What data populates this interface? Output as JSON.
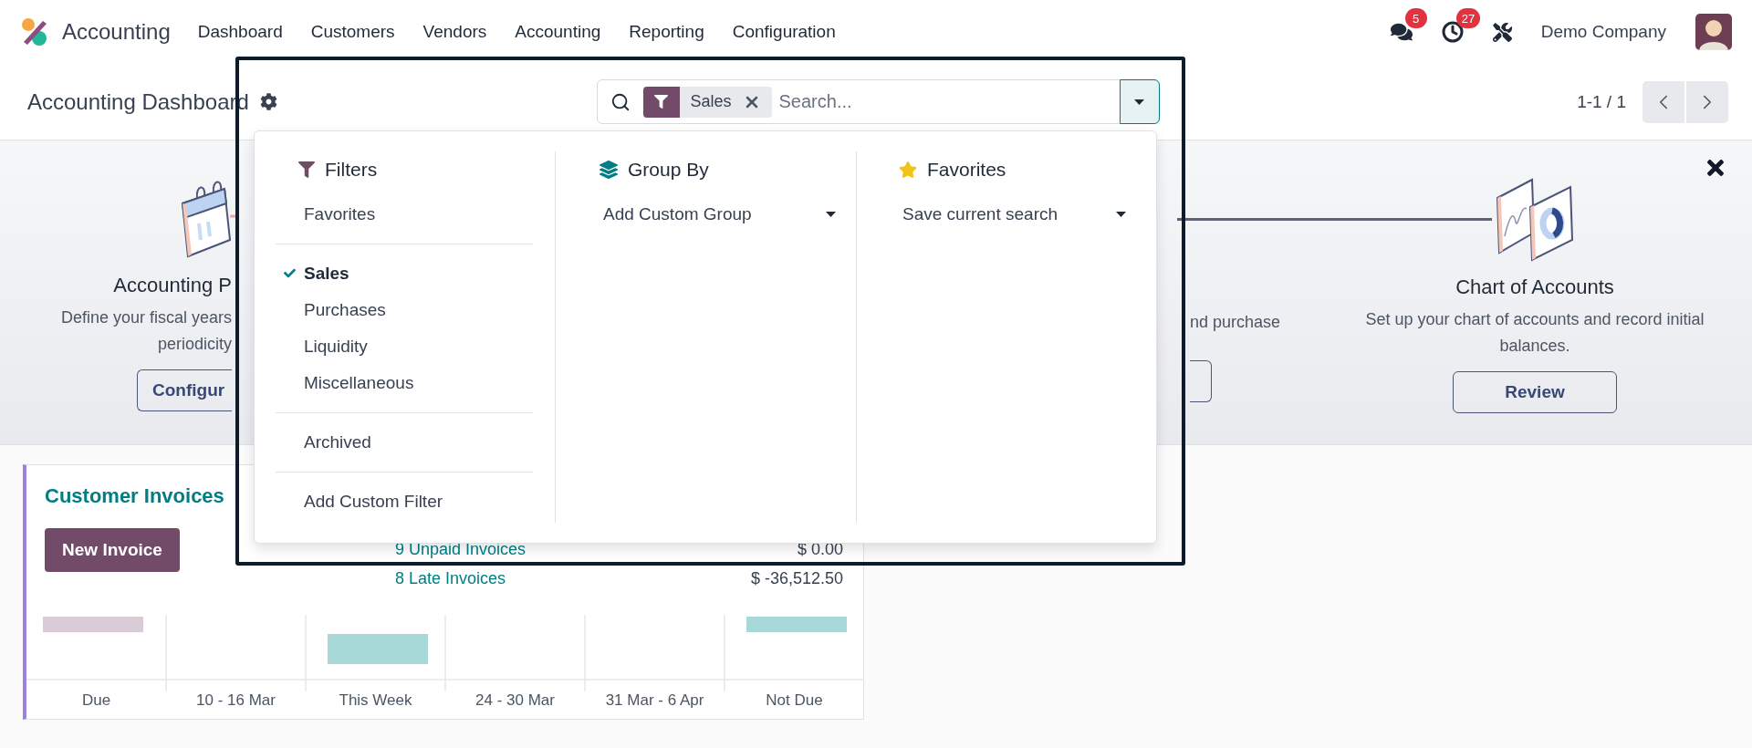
{
  "app": {
    "name": "Accounting"
  },
  "menu": [
    "Dashboard",
    "Customers",
    "Vendors",
    "Accounting",
    "Reporting",
    "Configuration"
  ],
  "systray": {
    "messages_count": "5",
    "activities_count": "27",
    "company": "Demo Company"
  },
  "control_panel": {
    "title": "Accounting Dashboard",
    "search": {
      "facets": [
        {
          "label": "Sales"
        }
      ],
      "placeholder": "Search..."
    },
    "pager": "1-1 / 1"
  },
  "onboarding": {
    "steps": [
      {
        "kind": "calendar",
        "title": "Accounting P",
        "description": "Define your fiscal years periodicity",
        "button": "Configur"
      },
      {
        "kind": "partial",
        "description": "nd purchase"
      },
      {
        "kind": "chart",
        "title": "Chart of Accounts",
        "description": "Set up your chart of accounts and record initial balances.",
        "button": "Review"
      }
    ]
  },
  "journal_card": {
    "title": "Customer Invoices",
    "button": "New Invoice",
    "lines": [
      {
        "label": "9 Unpaid Invoices",
        "amount": "$ 0.00"
      },
      {
        "label": "8 Late Invoices",
        "amount": "$ -36,512.50"
      }
    ],
    "graph_labels": [
      "Due",
      "10 - 16 Mar",
      "This Week",
      "24 - 30 Mar",
      "31 Mar - 6 Apr",
      "Not Due"
    ]
  },
  "search_panel": {
    "filters": {
      "title": "Filters",
      "groups": [
        {
          "items": [
            {
              "label": "Favorites",
              "selected": false
            }
          ]
        },
        {
          "items": [
            {
              "label": "Sales",
              "selected": true
            },
            {
              "label": "Purchases",
              "selected": false
            },
            {
              "label": "Liquidity",
              "selected": false
            },
            {
              "label": "Miscellaneous",
              "selected": false
            }
          ]
        },
        {
          "items": [
            {
              "label": "Archived",
              "selected": false
            }
          ]
        },
        {
          "items": [
            {
              "label": "Add Custom Filter",
              "selected": false
            }
          ]
        }
      ]
    },
    "group_by": {
      "title": "Group By",
      "select": "Add Custom Group"
    },
    "favorites": {
      "title": "Favorites",
      "select": "Save current search"
    }
  }
}
